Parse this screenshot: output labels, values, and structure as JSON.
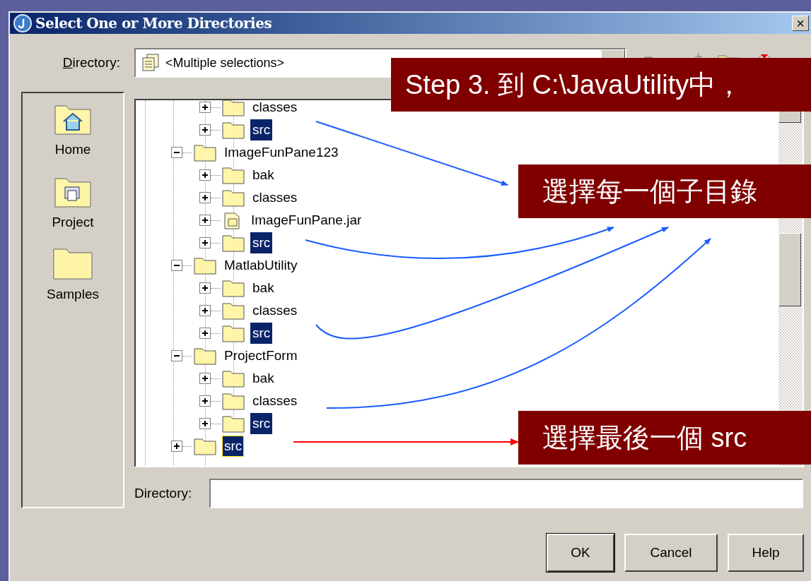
{
  "window": {
    "title": "Select One or More Directories",
    "close": "×"
  },
  "directory_combo": {
    "label": "Directory:",
    "value": "<Multiple selections>"
  },
  "places": [
    {
      "label": "Home",
      "kind": "home"
    },
    {
      "label": "Project",
      "kind": "project"
    },
    {
      "label": "Samples",
      "kind": "folder"
    }
  ],
  "tree": {
    "items": [
      {
        "children": [
          {
            "label": "classes",
            "kind": "folder",
            "expanded": false,
            "selected": false,
            "focused": false
          },
          {
            "label": "src",
            "kind": "folder",
            "expanded": false,
            "selected": true,
            "focused": false
          }
        ]
      },
      {
        "label": "ImageFunPane123",
        "kind": "folder",
        "expanded": true,
        "selected": false,
        "focused": false,
        "children": [
          {
            "label": "bak",
            "kind": "folder",
            "expanded": false,
            "selected": false,
            "focused": false
          },
          {
            "label": "classes",
            "kind": "folder",
            "expanded": false,
            "selected": false,
            "focused": false
          },
          {
            "label": "ImageFunPane.jar",
            "kind": "jar",
            "expanded": false,
            "selected": false,
            "focused": false
          },
          {
            "label": "src",
            "kind": "folder",
            "expanded": false,
            "selected": true,
            "focused": false
          }
        ]
      },
      {
        "label": "MatlabUtility",
        "kind": "folder",
        "expanded": true,
        "selected": false,
        "focused": false,
        "children": [
          {
            "label": "bak",
            "kind": "folder",
            "expanded": false,
            "selected": false,
            "focused": false
          },
          {
            "label": "classes",
            "kind": "folder",
            "expanded": false,
            "selected": false,
            "focused": false
          },
          {
            "label": "src",
            "kind": "folder",
            "expanded": false,
            "selected": true,
            "focused": false
          }
        ]
      },
      {
        "label": "ProjectForm",
        "kind": "folder",
        "expanded": true,
        "selected": false,
        "focused": false,
        "children": [
          {
            "label": "bak",
            "kind": "folder",
            "expanded": false,
            "selected": false,
            "focused": false
          },
          {
            "label": "classes",
            "kind": "folder",
            "expanded": false,
            "selected": false,
            "focused": false
          },
          {
            "label": "src",
            "kind": "folder",
            "expanded": false,
            "selected": true,
            "focused": false
          }
        ]
      },
      {
        "label": "src",
        "kind": "folder",
        "expanded": false,
        "selected": true,
        "focused": true
      }
    ]
  },
  "directory_field": {
    "label": "Directory:"
  },
  "buttons": [
    "OK",
    "Cancel",
    "Help"
  ],
  "annotations": [
    "Step 3. 到 C:\\JavaUtility中，",
    "選擇每一個子目錄",
    "選擇最後一個 src"
  ]
}
